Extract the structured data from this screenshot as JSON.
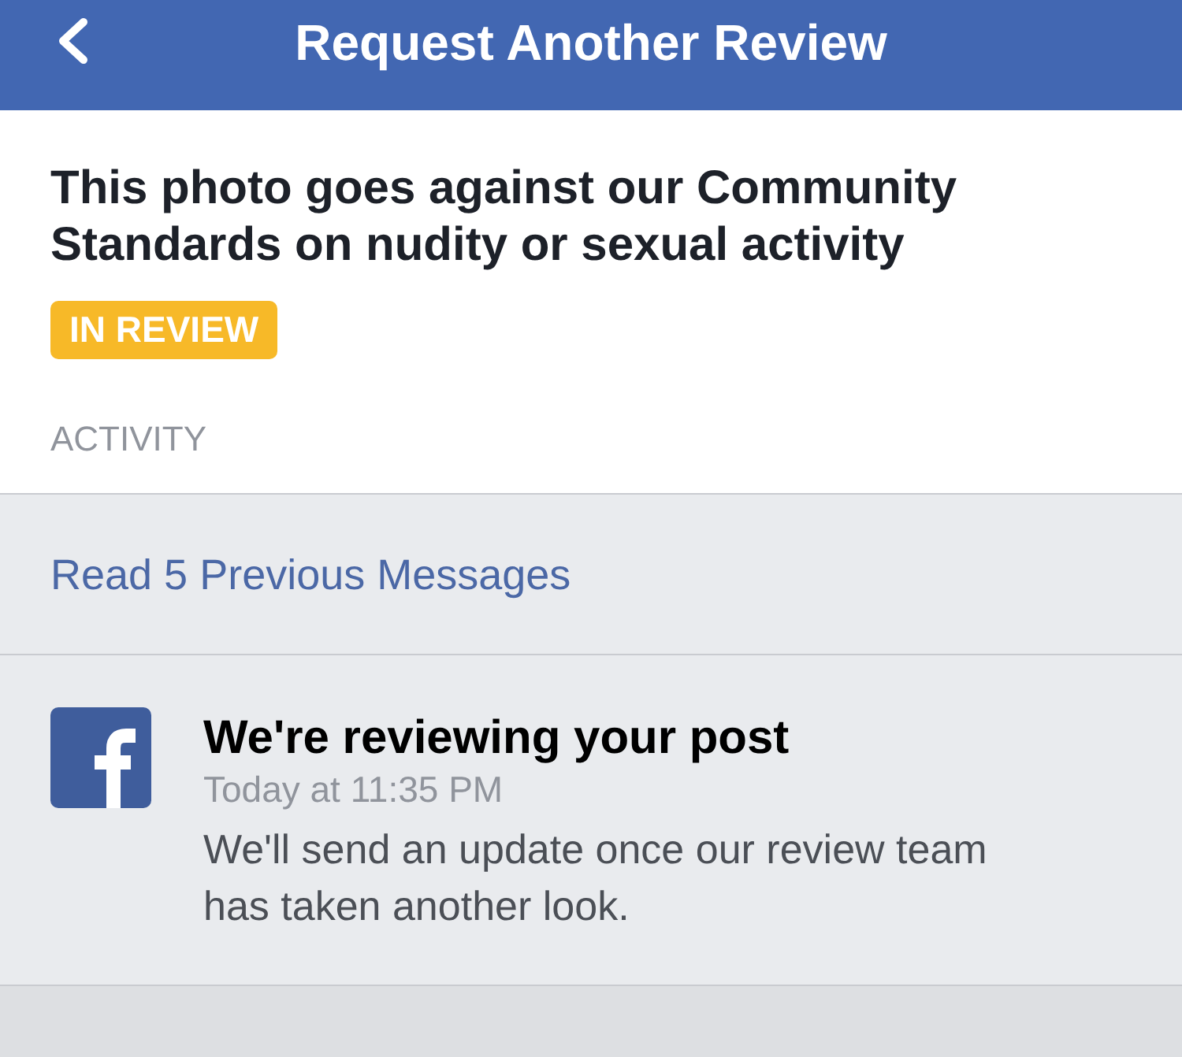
{
  "header": {
    "title": "Request Another Review"
  },
  "notice": {
    "title": "This photo goes against our Community Standards on nudity or sexual activity",
    "status_badge": "IN REVIEW",
    "section_label": "ACTIVITY"
  },
  "previous_messages_link": "Read 5 Previous Messages",
  "messages": [
    {
      "title": "We're reviewing your post",
      "time": "Today at 11:35 PM",
      "body": "We'll send an update once our review team has taken another look."
    }
  ]
}
